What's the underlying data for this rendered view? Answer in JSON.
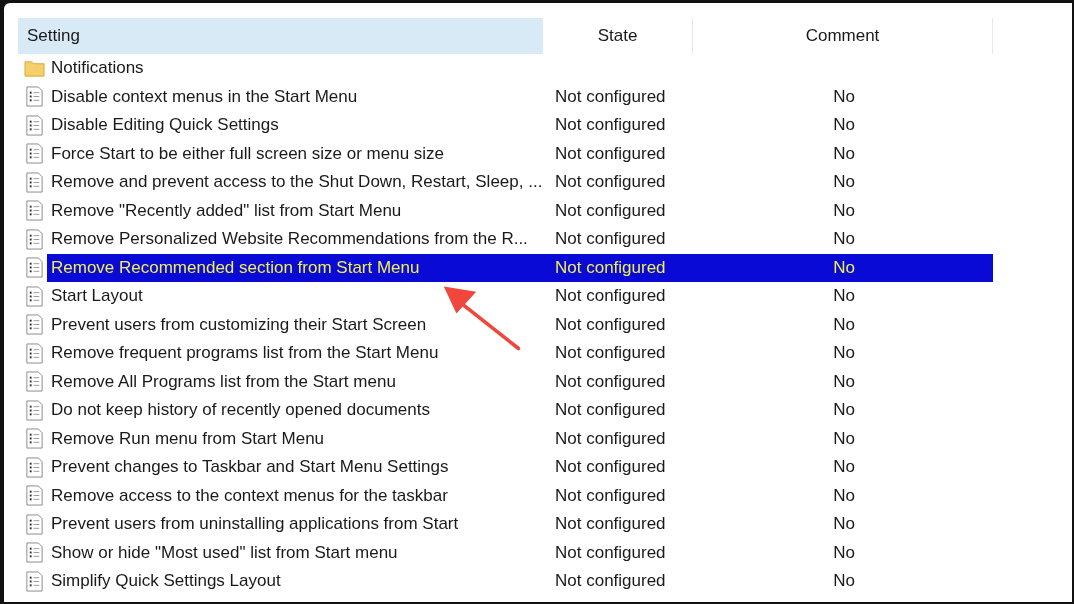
{
  "table": {
    "columns": [
      {
        "label": "Setting",
        "selected": true
      },
      {
        "label": "State",
        "selected": false
      },
      {
        "label": "Comment",
        "selected": false
      }
    ],
    "rows": [
      {
        "kind": "folder",
        "setting": "Notifications",
        "selected": false
      },
      {
        "kind": "policy",
        "setting": "Disable context menus in the Start Menu",
        "state": "Not configured",
        "comment": "No",
        "selected": false
      },
      {
        "kind": "policy",
        "setting": "Disable Editing Quick Settings",
        "state": "Not configured",
        "comment": "No",
        "selected": false
      },
      {
        "kind": "policy",
        "setting": "Force Start to be either full screen size or menu size",
        "state": "Not configured",
        "comment": "No",
        "selected": false
      },
      {
        "kind": "policy",
        "setting": "Remove and prevent access to the Shut Down, Restart, Sleep, ...",
        "state": "Not configured",
        "comment": "No",
        "selected": false
      },
      {
        "kind": "policy",
        "setting": "Remove \"Recently added\" list from Start Menu",
        "state": "Not configured",
        "comment": "No",
        "selected": false
      },
      {
        "kind": "policy",
        "setting": "Remove Personalized Website Recommendations from the R...",
        "state": "Not configured",
        "comment": "No",
        "selected": false
      },
      {
        "kind": "policy",
        "setting": "Remove Recommended section from Start Menu",
        "state": "Not configured",
        "comment": "No",
        "selected": true
      },
      {
        "kind": "policy",
        "setting": "Start Layout",
        "state": "Not configured",
        "comment": "No",
        "selected": false
      },
      {
        "kind": "policy",
        "setting": "Prevent users from customizing their Start Screen",
        "state": "Not configured",
        "comment": "No",
        "selected": false
      },
      {
        "kind": "policy",
        "setting": "Remove frequent programs list from the Start Menu",
        "state": "Not configured",
        "comment": "No",
        "selected": false
      },
      {
        "kind": "policy",
        "setting": "Remove All Programs list from the Start menu",
        "state": "Not configured",
        "comment": "No",
        "selected": false
      },
      {
        "kind": "policy",
        "setting": "Do not keep history of recently opened documents",
        "state": "Not configured",
        "comment": "No",
        "selected": false
      },
      {
        "kind": "policy",
        "setting": "Remove Run menu from Start Menu",
        "state": "Not configured",
        "comment": "No",
        "selected": false
      },
      {
        "kind": "policy",
        "setting": "Prevent changes to Taskbar and Start Menu Settings",
        "state": "Not configured",
        "comment": "No",
        "selected": false
      },
      {
        "kind": "policy",
        "setting": "Remove access to the context menus for the taskbar",
        "state": "Not configured",
        "comment": "No",
        "selected": false
      },
      {
        "kind": "policy",
        "setting": "Prevent users from uninstalling applications from Start",
        "state": "Not configured",
        "comment": "No",
        "selected": false
      },
      {
        "kind": "policy",
        "setting": "Show or hide \"Most used\" list from Start menu",
        "state": "Not configured",
        "comment": "No",
        "selected": false
      },
      {
        "kind": "policy",
        "setting": "Simplify Quick Settings Layout",
        "state": "Not configured",
        "comment": "No",
        "selected": false
      }
    ]
  }
}
